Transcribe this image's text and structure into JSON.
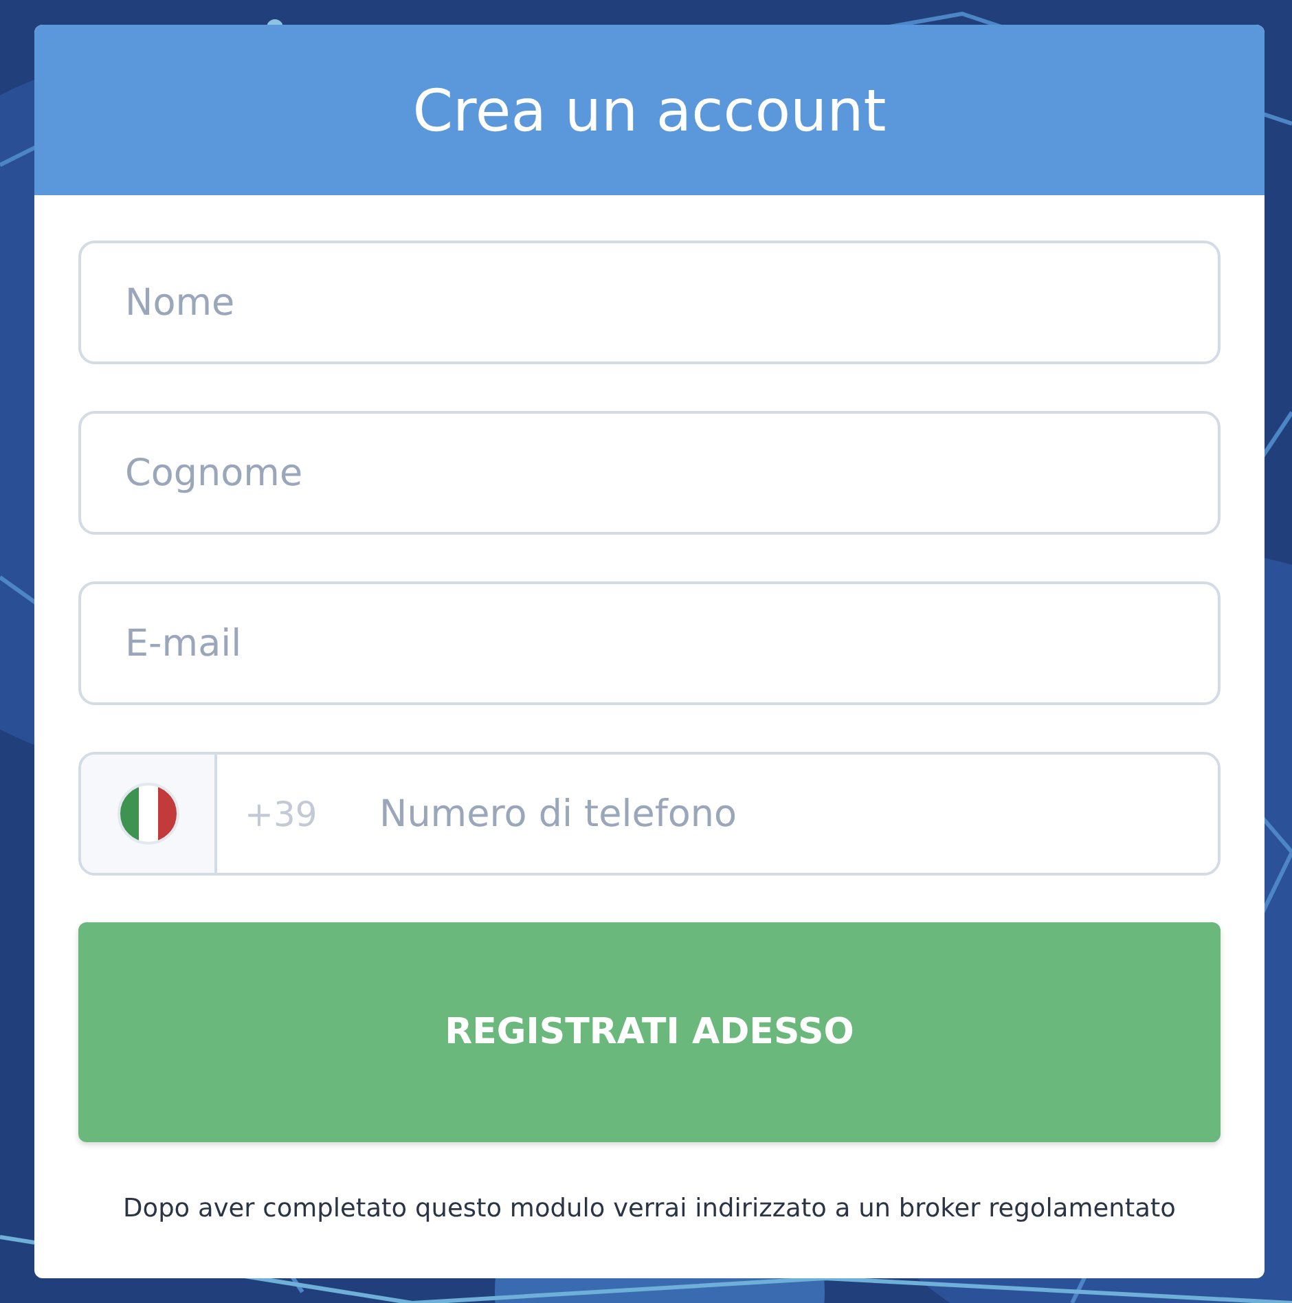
{
  "header": {
    "title": "Crea un account"
  },
  "fields": [
    {
      "kind": "text",
      "placeholder": "Nome"
    },
    {
      "kind": "text",
      "placeholder": "Cognome"
    },
    {
      "kind": "text",
      "placeholder": "E-mail"
    },
    {
      "kind": "phone",
      "prefix": "+39",
      "placeholder": "Numero di telefono"
    }
  ],
  "submit": {
    "label": "REGISTRATI ADESSO"
  },
  "note": "Dopo aver completato questo modulo verrai indirizzato a un broker regolamentato"
}
